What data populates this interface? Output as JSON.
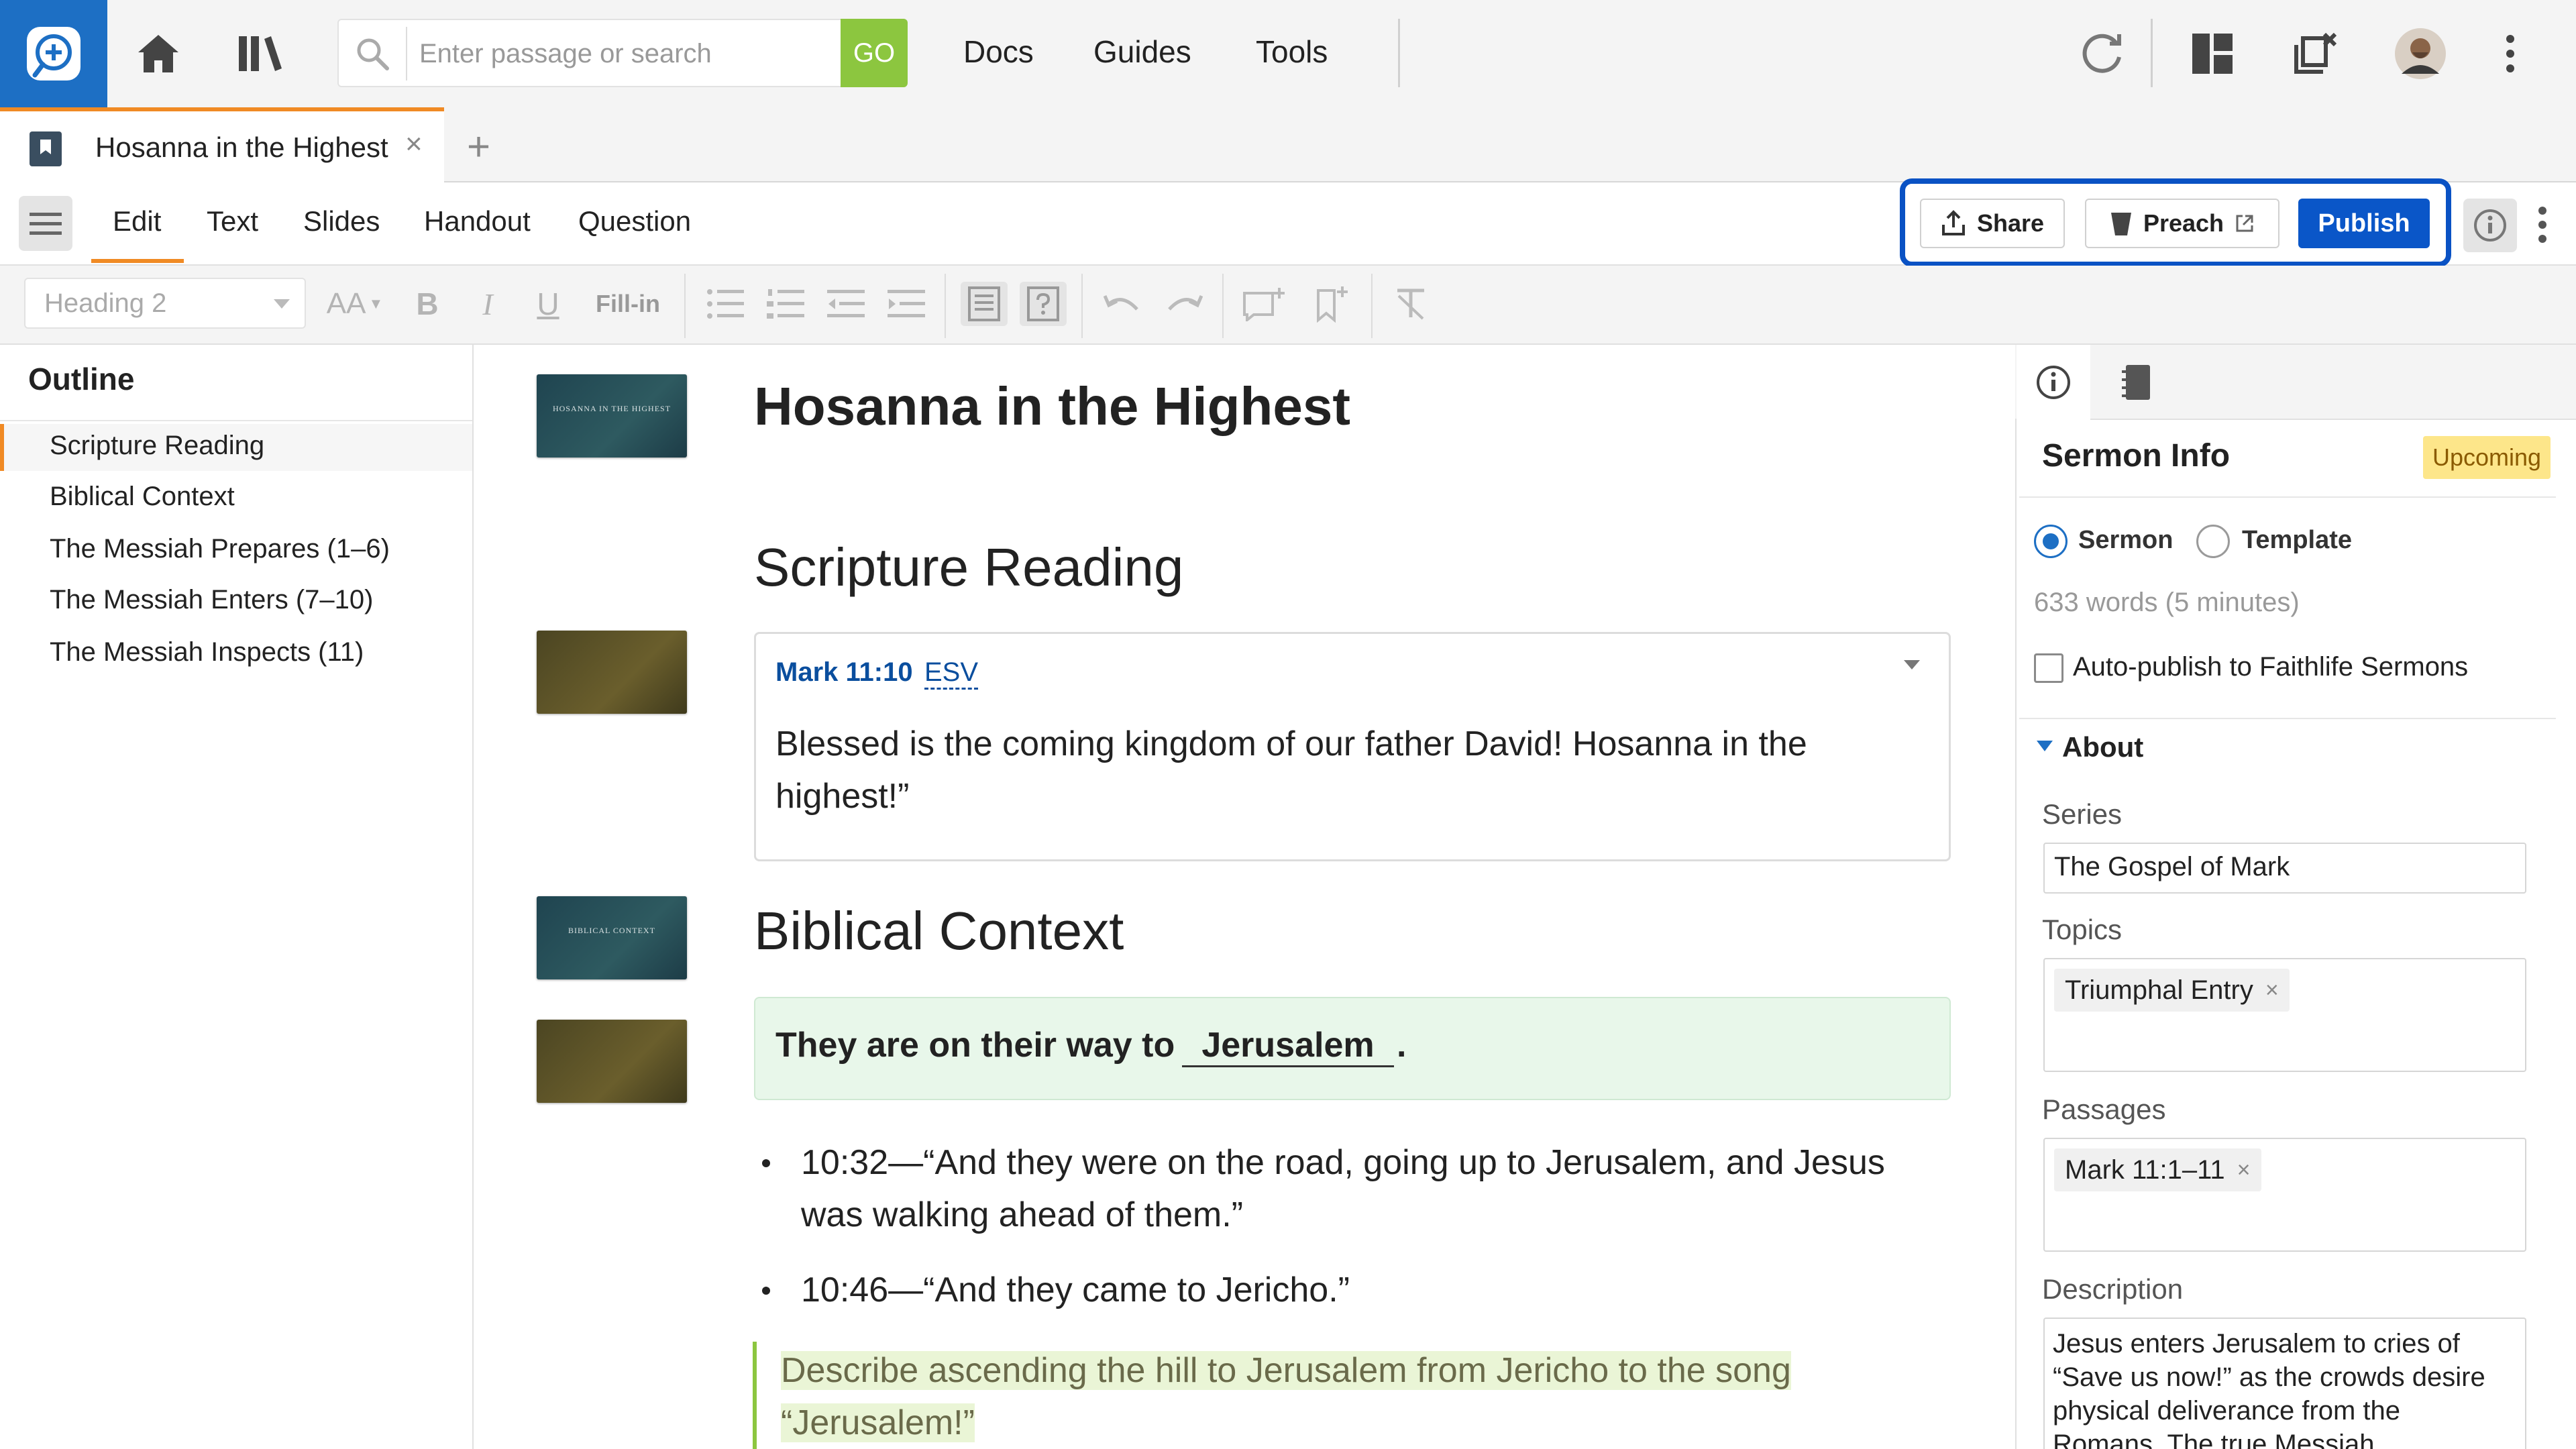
{
  "search": {
    "placeholder": "Enter passage or search",
    "go_label": "GO"
  },
  "nav": {
    "docs": "Docs",
    "guides": "Guides",
    "tools": "Tools"
  },
  "tab": {
    "title": "Hosanna in the Highest",
    "close": "×",
    "add": "+"
  },
  "menu": {
    "edit": "Edit",
    "text": "Text",
    "slides": "Slides",
    "handout": "Handout",
    "question": "Question"
  },
  "actions": {
    "share": "Share",
    "preach": "Preach",
    "publish": "Publish"
  },
  "format": {
    "style": "Heading 2",
    "aa": "AA",
    "bold": "B",
    "italic": "I",
    "underline": "U",
    "fillin": "Fill-in"
  },
  "outline": {
    "title": "Outline",
    "items": [
      "Scripture Reading",
      "Biblical Context",
      "The Messiah Prepares (1–6)",
      "The Messiah Enters (7–10)",
      "The Messiah Inspects (11)"
    ]
  },
  "editor": {
    "title": "Hosanna in the Highest",
    "thumb_title": "HOSANNA IN THE HIGHEST",
    "thumb_context": "BIBLICAL CONTEXT",
    "section1": "Scripture Reading",
    "verse_ref": "Mark 11:10",
    "verse_version": "ESV",
    "verse_text": "Blessed is the coming kingdom of our father David! Hosanna in the highest!”",
    "section2": "Biblical Context",
    "fillin_text": "They are on their way to",
    "fillin_answer": "Jerusalem",
    "fillin_end": ".",
    "bullets": [
      "10:32—“And they were on the road, going up to Jerusalem, and Jesus was walking ahead of them.”",
      "10:46—“And they came to Jericho.”"
    ],
    "note": "Describe ascending the hill to Jerusalem from Jericho to the song “Jerusalem!”"
  },
  "panel": {
    "title": "Sermon Info",
    "status": "Upcoming",
    "radio_sermon": "Sermon",
    "radio_template": "Template",
    "word_count": "633 words (5 minutes)",
    "autopublish": "Auto-publish to Faithlife Sermons",
    "about": "About",
    "series_label": "Series",
    "series_value": "The Gospel of Mark",
    "topics_label": "Topics",
    "topic_chip": "Triumphal Entry",
    "passages_label": "Passages",
    "passage_chip": "Mark 11:1–11",
    "description_label": "Description",
    "description": "Jesus enters Jerusalem to cries of “Save us now!” as the crowds desire physical deliverance from the Romans. The true Messiah"
  },
  "colors": {
    "accent": "#f08a24",
    "brand": "#1d6fc4",
    "publish": "#0a56c8",
    "go": "#8cc63f",
    "highlight": "#0a52c4"
  }
}
